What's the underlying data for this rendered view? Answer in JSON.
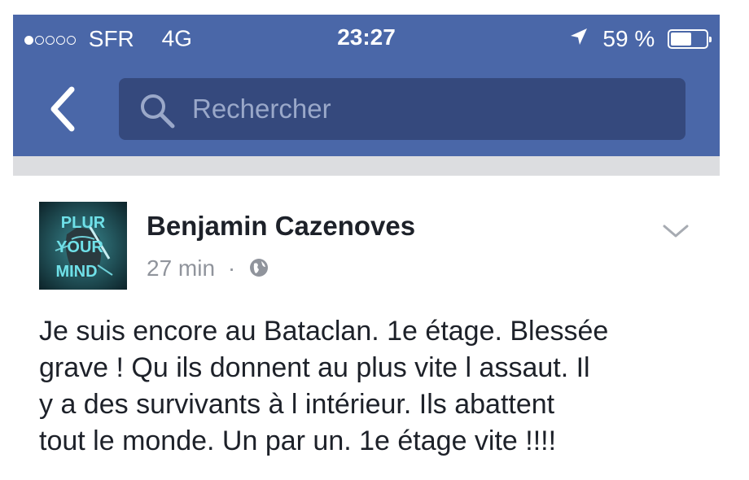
{
  "status_bar": {
    "carrier": "SFR",
    "network": "4G",
    "time": "23:27",
    "battery_percent": "59 %",
    "battery_level": 0.59,
    "signal_bars_filled": 1,
    "signal_bars_total": 5
  },
  "nav": {
    "back_icon": "chevron-left-icon",
    "search": {
      "icon": "search-icon",
      "placeholder": "Rechercher"
    }
  },
  "post": {
    "author": "Benjamin Cazenoves",
    "time": "27 min",
    "separator": "·",
    "privacy_icon": "globe-icon",
    "menu_icon": "chevron-down-icon",
    "text_lines": [
      "Je suis encore au Bataclan. 1e étage. Blessée",
      "grave ! Qu ils donnent au plus vite l assaut. Il",
      "y a des survivants à l intérieur. Ils abattent",
      "tout le monde. Un par un. 1e étage vite !!!!"
    ],
    "avatar_text": [
      "PLUR",
      "YOUR",
      "MIND"
    ]
  },
  "colors": {
    "nav_bar": "#4a67a8",
    "search_field": "#35497d",
    "divider": "#dcdde0",
    "author_text": "#1d2129",
    "meta_text": "#90949c"
  }
}
